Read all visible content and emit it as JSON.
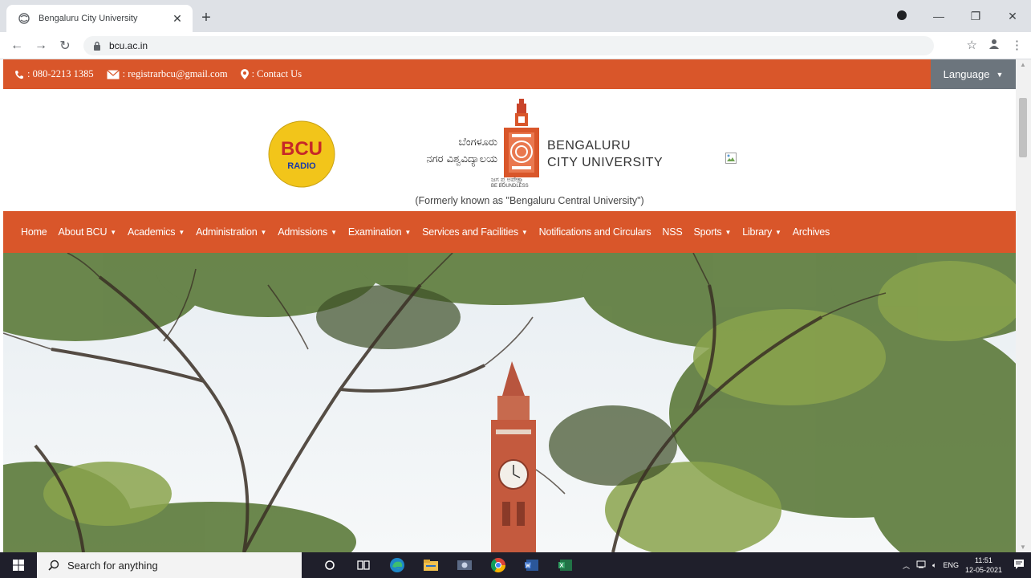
{
  "browser": {
    "tab_title": "Bengaluru City University",
    "url": "bcu.ac.in"
  },
  "topbar": {
    "phone": ": 080-2213 1385",
    "email": ": registrarbcu@gmail.com",
    "contact": ": Contact Us",
    "language_label": "Language"
  },
  "header": {
    "radio_logo_line1": "BCU",
    "radio_logo_line2": "RADIO",
    "kannada_line1": "ಬೆಂಗಳೂರು",
    "kannada_line2": "ನಗರ ವಿಶ್ವವಿದ್ಯಾಲಯ",
    "uni_name_line1": "BENGALURU",
    "uni_name_line2": "CITY UNIVERSITY",
    "motto_kannada": "ಜಗ ಪ್ರ ಅಪೇಕ್ಷಾ",
    "motto_english": "BE BOUNDLESS",
    "formerly": "(Formerly known as \"Bengaluru Central University\")"
  },
  "nav": {
    "items": [
      {
        "label": "Home",
        "dropdown": false
      },
      {
        "label": "About BCU",
        "dropdown": true
      },
      {
        "label": "Academics",
        "dropdown": true
      },
      {
        "label": "Administration",
        "dropdown": true
      },
      {
        "label": "Admissions",
        "dropdown": true
      },
      {
        "label": "Examination",
        "dropdown": true
      },
      {
        "label": "Services and Facilities",
        "dropdown": true
      },
      {
        "label": "Notifications and Circulars",
        "dropdown": false
      },
      {
        "label": "NSS",
        "dropdown": false
      },
      {
        "label": "Sports",
        "dropdown": true
      },
      {
        "label": "Library",
        "dropdown": true
      },
      {
        "label": "Archives",
        "dropdown": false
      }
    ]
  },
  "taskbar": {
    "search_placeholder": "Search for anything",
    "lang": "ENG",
    "time": "11:51",
    "date": "12-05-2021"
  },
  "colors": {
    "brand_orange": "#d9562a",
    "language_button": "#6c757d"
  }
}
